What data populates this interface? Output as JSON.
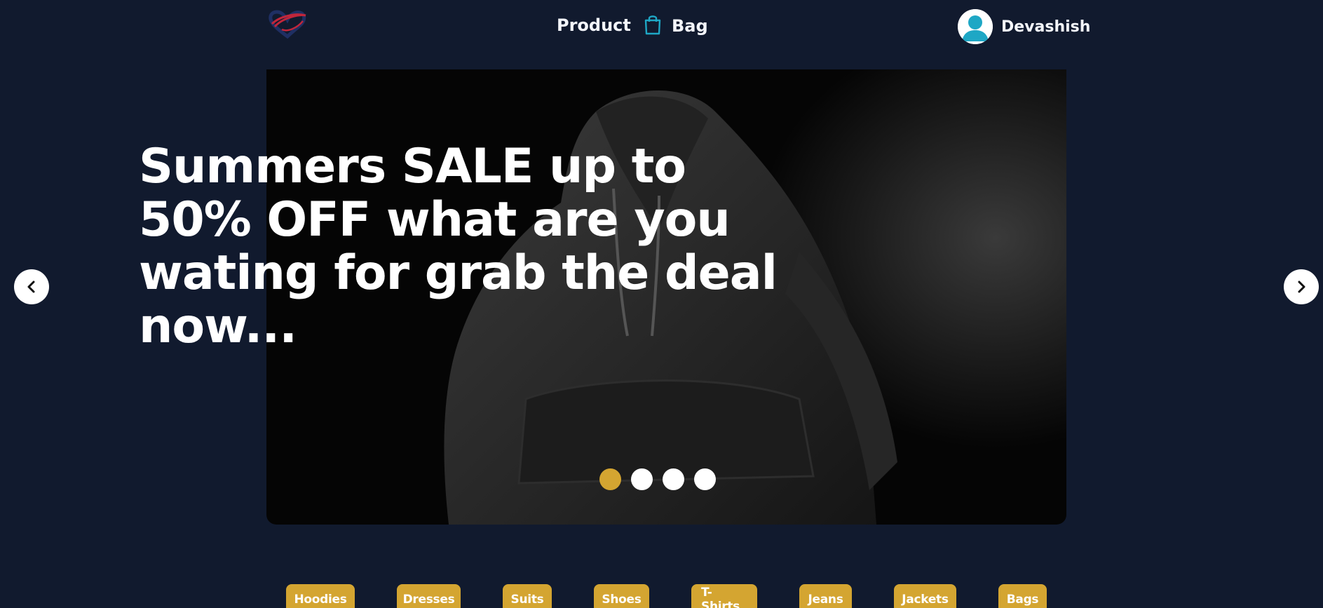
{
  "header": {
    "logo_name": "heart-logo",
    "nav": {
      "product_label": "Product",
      "bag_label": "Bag"
    },
    "user": {
      "name": "Devashish"
    }
  },
  "hero": {
    "headline": "Summers SALE up to 50% OFF what are you wating for grab the deal now...",
    "slides_count": 4,
    "active_slide": 1
  },
  "categories": [
    "Hoodies",
    "Dresses",
    "Suits",
    "Shoes",
    "T-Shirts",
    "Jeans",
    "Jackets",
    "Bags"
  ],
  "colors": {
    "background": "#111a2e",
    "accent": "#d4a531",
    "bag_icon": "#1ea7c5",
    "avatar": "#1ea7c5"
  }
}
